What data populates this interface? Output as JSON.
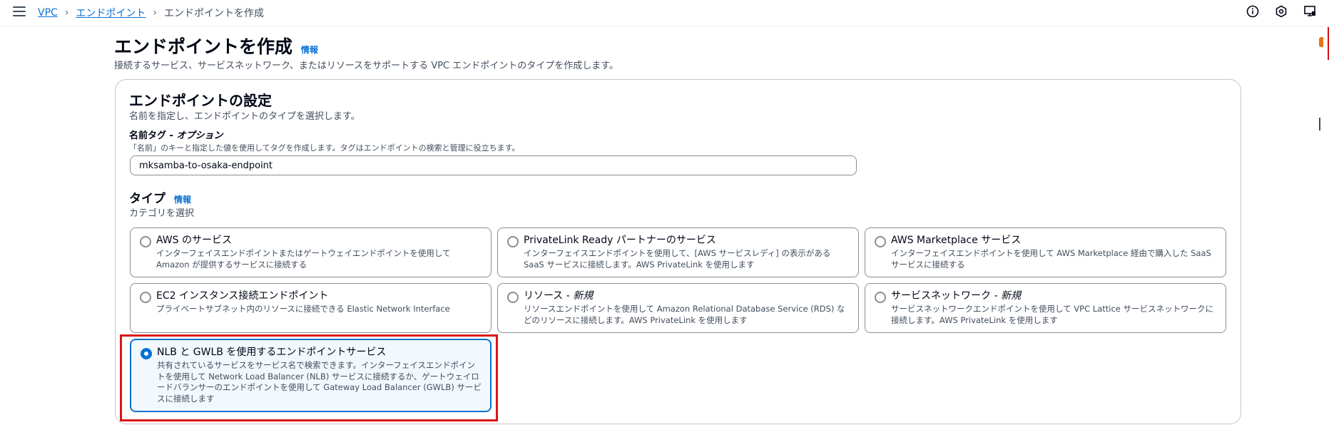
{
  "breadcrumb": {
    "items": [
      {
        "label": "VPC"
      },
      {
        "label": "エンドポイント"
      },
      {
        "label": "エンドポイントを作成"
      }
    ]
  },
  "page": {
    "title": "エンドポイントを作成",
    "info": "情報",
    "description": "接続するサービス、サービスネットワーク、またはリソースをサポートする VPC エンドポイントのタイプを作成します。"
  },
  "settings": {
    "title": "エンドポイントの設定",
    "description": "名前を指定し、エンドポイントのタイプを選択します。",
    "name_tag_label": "名前タグ - ",
    "name_tag_optional": "オプション",
    "name_tag_hint": "「名前」のキーと指定した値を使用してタグを作成します。タグはエンドポイントの検索と管理に役立ちます。",
    "name_tag_value": "mksamba-to-osaka-endpoint"
  },
  "type": {
    "title": "タイプ",
    "info": "情報",
    "description": "カテゴリを選択",
    "options": [
      {
        "label": "AWS のサービス",
        "label_suffix": "",
        "description": "インターフェイスエンドポイントまたはゲートウェイエンドポイントを使用して Amazon が提供するサービスに接続する",
        "selected": false
      },
      {
        "label": "PrivateLink Ready パートナーのサービス",
        "label_suffix": "",
        "description": "インターフェイスエンドポイントを使用して、[AWS サービスレディ] の表示がある SaaS サービスに接続します。AWS PrivateLink を使用します",
        "selected": false
      },
      {
        "label": "AWS Marketplace サービス",
        "label_suffix": "",
        "description": "インターフェイスエンドポイントを使用して AWS Marketplace 経由で購入した SaaS サービスに接続する",
        "selected": false
      },
      {
        "label": "EC2 インスタンス接続エンドポイント",
        "label_suffix": "",
        "description": "プライベートサブネット内のリソースに接続できる Elastic Network Interface",
        "selected": false
      },
      {
        "label": "リソース - ",
        "label_suffix": "新規",
        "description": "リソースエンドポイントを使用して Amazon Relational Database Service (RDS) などのリソースに接続します。AWS PrivateLink を使用します",
        "selected": false
      },
      {
        "label": "サービスネットワーク - ",
        "label_suffix": "新規",
        "description": "サービスネットワークエンドポイントを使用して VPC Lattice サービスネットワークに接続します。AWS PrivateLink を使用します",
        "selected": false
      },
      {
        "label": "NLB と GWLB を使用するエンドポイントサービス",
        "label_suffix": "",
        "description": "共有されているサービスをサービス名で検索できます。インターフェイスエンドポイントを使用して Network Load Balancer (NLB) サービスに接続するか、ゲートウェイロードバランサーのエンドポイントを使用して Gateway Load Balancer (GWLB) サービスに接続します",
        "selected": true
      }
    ]
  },
  "icons": [
    "menu-icon",
    "chevron-right-icon",
    "info-circle-icon",
    "settings-hexagon-icon",
    "notifications-icon"
  ],
  "colors": {
    "link": "#0972d3",
    "selected_border": "#0972d3",
    "highlight": "#d91515"
  }
}
